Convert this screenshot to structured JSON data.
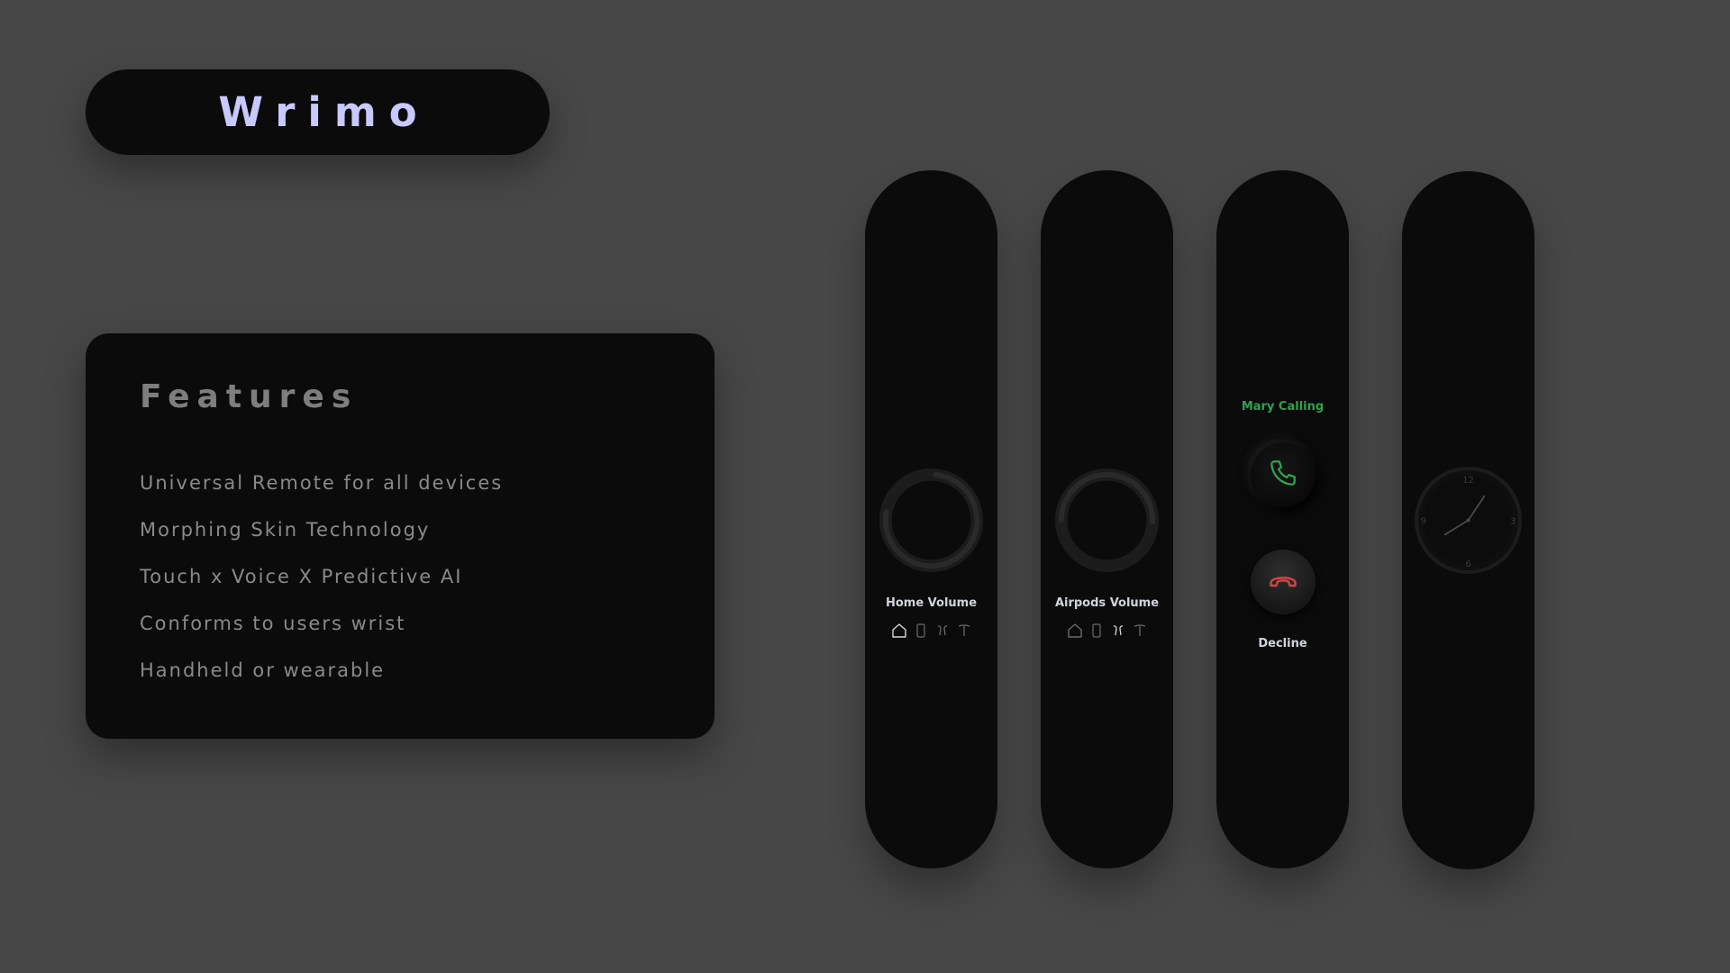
{
  "brand": {
    "name": "Wrimo",
    "color": "#c9c9ff"
  },
  "features": {
    "title": "Features",
    "items": [
      "Universal Remote for all devices",
      "Morphing Skin Technology",
      "Touch x Voice X Predictive AI",
      "Conforms to users wrist",
      "Handheld or wearable"
    ]
  },
  "devices": {
    "home_volume": {
      "label": "Home Volume",
      "source_icons": [
        "home-icon",
        "phone-icon",
        "airpods-icon",
        "tesla-icon"
      ],
      "active_source": "home-icon"
    },
    "airpods_volume": {
      "label": "Airpods Volume",
      "source_icons": [
        "home-icon",
        "phone-icon",
        "airpods-icon",
        "tesla-icon"
      ],
      "active_source": "airpods-icon"
    },
    "call": {
      "caller_text": "Mary Calling",
      "accept_icon": "phone-accept-icon",
      "decline_icon": "phone-decline-icon",
      "decline_label": "Decline",
      "accept_color": "#2fa24e",
      "decline_color": "#d64545"
    },
    "clock": {
      "icon": "clock-face-icon"
    }
  },
  "colors": {
    "background": "#474747",
    "panel": "#0b0b0c",
    "muted_text": "#8a8a8a",
    "label_text": "#d2d4dc"
  }
}
